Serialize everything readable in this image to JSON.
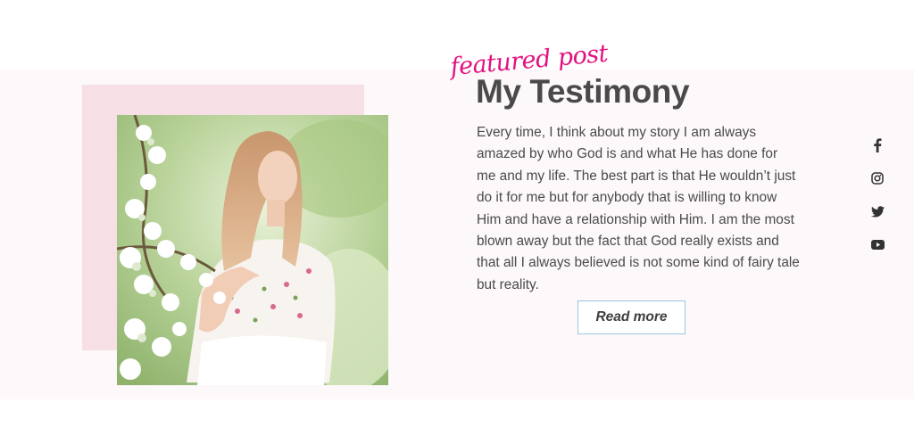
{
  "featured": {
    "label": "featured post",
    "title": "My Testimony",
    "body": "Every time, I think about my story I am always amazed by who God is and what He has done for me and my life. The best part is that He wouldn’t just do it for me but for anybody that is willing to know Him and have a relationship with Him. I am the most blown away but the fact that God really exists and that all I always believed is not some kind of fairy tale but reality.",
    "button_label": "Read more"
  },
  "social": [
    {
      "icon": "facebook-icon"
    },
    {
      "icon": "instagram-icon"
    },
    {
      "icon": "twitter-icon"
    },
    {
      "icon": "youtube-icon"
    }
  ],
  "colors": {
    "accent_pink": "#e3117f",
    "pink_block": "#f6e0e6",
    "title_text": "#4a4a4a",
    "button_border": "#9cc6dd"
  }
}
